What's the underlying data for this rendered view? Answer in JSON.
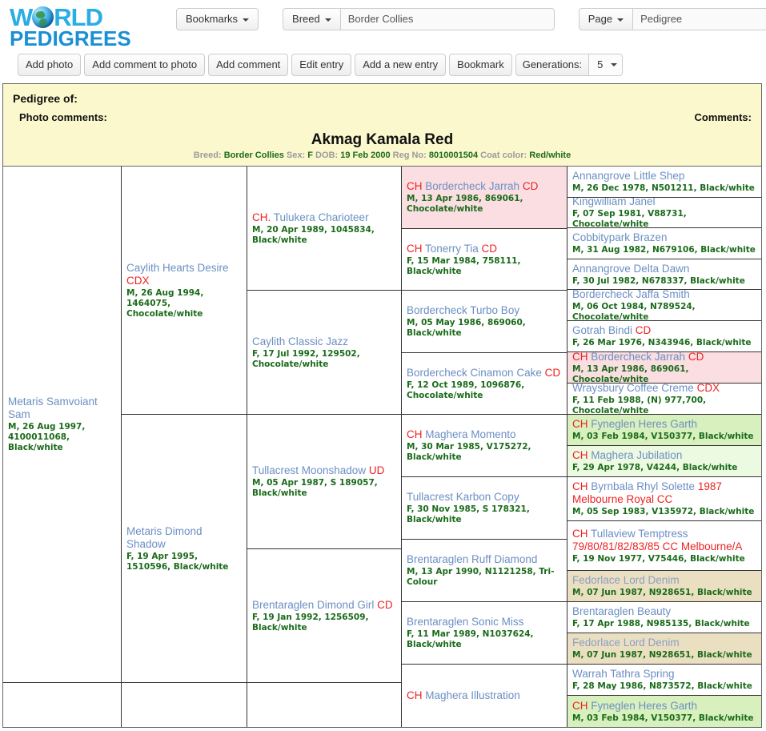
{
  "brand": {
    "line1_a": "W",
    "line1_b": "RLD",
    "line2": "PEDIGREES",
    "logo_icon": "globe-icon"
  },
  "topbar": {
    "bookmarks_label": "Bookmarks",
    "breed_label": "Breed",
    "breed_value": "Border Collies",
    "page_label": "Page",
    "page_value": "Pedigree"
  },
  "actions": {
    "add_photo": "Add photo",
    "add_comment_to_photo": "Add comment to photo",
    "add_comment": "Add comment",
    "edit_entry": "Edit entry",
    "add_new_entry": "Add a new entry",
    "bookmark": "Bookmark",
    "generations_label": "Generations:",
    "generations_value": "5"
  },
  "header": {
    "pedigree_of": "Pedigree of:",
    "photo_comments": "Photo comments:",
    "comments": "Comments:",
    "subject_name": "Akmag Kamala Red",
    "breed_label": "Breed:",
    "breed_value": "Border Collies",
    "sex_label": "Sex:",
    "sex_value": "F",
    "dob_label": "DOB:",
    "dob_value": "19 Feb 2000",
    "reg_label": "Reg No:",
    "reg_value": "8010001504",
    "coat_label": "Coat color:",
    "coat_value": "Red/white"
  },
  "colors": {
    "name_link": "#6b8fc4",
    "title_red": "#ee2222",
    "meta_green": "#1a6b1a",
    "band_yellow": "#fbf8cd",
    "hl_pink": "#fadee1",
    "hl_green": "#d8f0bd",
    "hl_green_light": "#edfae2",
    "hl_tan": "#ebdfc1"
  },
  "gen2": [
    {
      "name": "Metaris Samvoiant Sam",
      "title": "",
      "meta": "M, 26 Aug 1997, 4100011068, Black/white"
    },
    {
      "name": "",
      "title": "",
      "meta": ""
    }
  ],
  "gen3": [
    {
      "name": "Caylith Hearts Desire",
      "title": "CDX",
      "meta": "M, 26 Aug 1994, 1464075, Chocolate/white"
    },
    {
      "name": "Metaris Dimond Shadow",
      "title": "",
      "meta": "F, 19 Apr 1995, 1510596, Black/white"
    },
    {
      "name": "",
      "title": "",
      "meta": ""
    }
  ],
  "gen4": [
    {
      "name": "CH. Tulukera Charioteer",
      "title_prefix": "CH.",
      "name_rest": " Tulukera Charioteer",
      "meta": "M, 20 Apr 1989, 1045834, Black/white"
    },
    {
      "name": "Caylith Classic Jazz",
      "meta": "F, 17 Jul 1992, 129502, Chocolate/white"
    },
    {
      "name": "Tullacrest Moonshadow",
      "title_suffix": "UD",
      "meta": "M, 05 Apr 1987, S 189057, Black/white"
    },
    {
      "name": "Brentaraglen Dimond Girl",
      "title_suffix": "CD",
      "meta": "F, 19 Jan 1992, 1256509, Black/white"
    },
    {
      "name": "",
      "meta": ""
    }
  ],
  "gen5": [
    {
      "pre": "CH",
      "name": "Bordercheck Jarrah",
      "suf": "CD",
      "meta": "M, 13 Apr 1986, 869061, Chocolate/white",
      "hl": "pink"
    },
    {
      "pre": "CH",
      "name": "Tonerry Tia",
      "suf": "CD",
      "meta": "F, 15 Mar 1984, 758111, Black/white",
      "hl": ""
    },
    {
      "pre": "",
      "name": "Bordercheck Turbo Boy",
      "suf": "",
      "meta": "M, 05 May 1986, 869060, Black/white",
      "hl": ""
    },
    {
      "pre": "",
      "name": "Bordercheck Cinamon Cake",
      "suf": "CD",
      "meta": "F, 12 Oct 1989, 1096876, Chocolate/white",
      "hl": ""
    },
    {
      "pre": "CH",
      "name": "Maghera Momento",
      "suf": "",
      "meta": "M, 30 Mar 1985, V175272, Black/white",
      "hl": ""
    },
    {
      "pre": "",
      "name": "Tullacrest Karbon Copy",
      "suf": "",
      "meta": "F, 30 Nov 1985, S 178321, Black/white",
      "hl": ""
    },
    {
      "pre": "",
      "name": "Brentaraglen Ruff Diamond",
      "suf": "",
      "meta": "M, 13 Apr 1990, N1121258, Tri-Colour",
      "hl": ""
    },
    {
      "pre": "",
      "name": "Brentaraglen Sonic Miss",
      "suf": "",
      "meta": "F, 11 Mar 1989, N1037624, Black/white",
      "hl": ""
    },
    {
      "pre": "CH",
      "name": "Maghera Illustration",
      "suf": "",
      "meta": "",
      "hl": ""
    }
  ],
  "gen6": [
    {
      "pre": "",
      "name": "Annangrove Little Shep",
      "suf": "",
      "meta": "M, 26 Dec 1978, N501211, Black/white",
      "hl": ""
    },
    {
      "pre": "",
      "name": "Kingwilliam Janel",
      "suf": "",
      "meta": "F, 07 Sep 1981, V88731, Chocolate/white",
      "hl": ""
    },
    {
      "pre": "",
      "name": "Cobbitypark Brazen",
      "suf": "",
      "meta": "M, 31 Aug 1982, N679106, Black/white",
      "hl": ""
    },
    {
      "pre": "",
      "name": "Annangrove Delta Dawn",
      "suf": "",
      "meta": "F, 30 Jul 1982, N678337, Black/white",
      "hl": ""
    },
    {
      "pre": "",
      "name": "Bordercheck Jaffa Smith",
      "suf": "",
      "meta": "M, 06 Oct 1984, N789524, Chocolate/white",
      "hl": ""
    },
    {
      "pre": "",
      "name": "Gotrah Bindi",
      "suf": "CD",
      "meta": "F, 26 Mar 1976, N343946, Black/white",
      "hl": ""
    },
    {
      "pre": "CH",
      "name": "Bordercheck Jarrah",
      "suf": "CD",
      "meta": "M, 13 Apr 1986, 869061, Chocolate/white",
      "hl": "pink"
    },
    {
      "pre": "",
      "name": "Wraysbury Coffee Creme",
      "suf": "CDX",
      "meta": "F, 11 Feb 1988, (N) 977,700, Chocolate/white",
      "hl": ""
    },
    {
      "pre": "CH",
      "name": "Fyneglen Heres Garth",
      "suf": "",
      "meta": "M, 03 Feb 1984, V150377, Black/white",
      "hl": "green"
    },
    {
      "pre": "CH",
      "name": "Maghera Jubilation",
      "suf": "",
      "meta": "F, 29 Apr 1978, V4244, Black/white",
      "hl": "green2"
    },
    {
      "pre": "CH",
      "name": "Byrnbala Rhyl Solette",
      "suf": "1987 Melbourne Royal CC",
      "meta": "M, 05 Sep 1983, V135972, Black/white",
      "hl": ""
    },
    {
      "pre": "CH",
      "name": "Tullaview Temptress",
      "suf": "79/80/81/82/83/85 CC Melbourne/A",
      "meta": "F, 19 Nov 1977, V75446, Black/white",
      "hl": ""
    },
    {
      "pre": "",
      "name": "Fedorlace Lord Denim",
      "suf": "",
      "meta": "M, 07 Jun 1987, N928651, Black/white",
      "hl": "tan"
    },
    {
      "pre": "",
      "name": "Brentaraglen Beauty",
      "suf": "",
      "meta": "F, 17 Apr 1988, N985135, Black/white",
      "hl": ""
    },
    {
      "pre": "",
      "name": "Fedorlace Lord Denim",
      "suf": "",
      "meta": "M, 07 Jun 1987, N928651, Black/white",
      "hl": "tan"
    },
    {
      "pre": "",
      "name": "Warrah Tathra Spring",
      "suf": "",
      "meta": "F, 28 May 1986, N873572, Black/white",
      "hl": ""
    },
    {
      "pre": "CH",
      "name": "Fyneglen Heres Garth",
      "suf": "",
      "meta": "M, 03 Feb 1984, V150377, Black/white",
      "hl": "green"
    }
  ]
}
